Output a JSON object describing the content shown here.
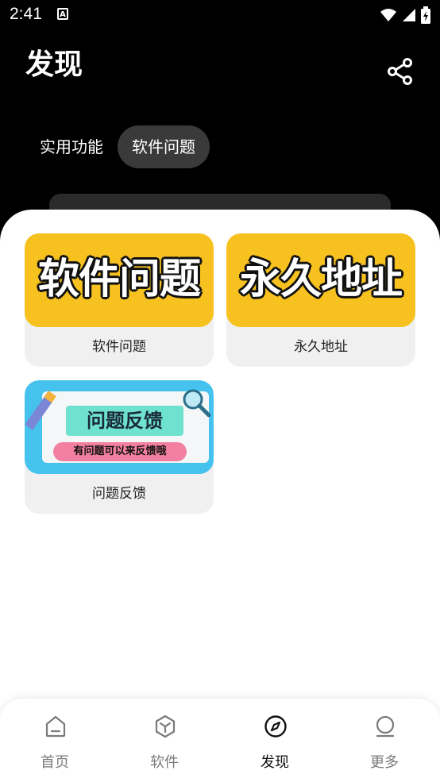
{
  "status_bar": {
    "time": "2:41",
    "notification_letter": "A"
  },
  "header": {
    "title": "发现"
  },
  "tabs": [
    {
      "label": "实用功能",
      "active": false
    },
    {
      "label": "软件问题",
      "active": true
    }
  ],
  "cards": [
    {
      "thumb_text": "软件问题",
      "label": "软件问题",
      "thumb_color": "#f7c21f"
    },
    {
      "thumb_text": "永久地址",
      "label": "永久地址",
      "thumb_color": "#f7c21f"
    },
    {
      "thumb_title": "问题反馈",
      "thumb_sub": "有问题可以来反馈哦",
      "label": "问题反馈",
      "thumb_color": "#45c3ee"
    }
  ],
  "bottom_nav": [
    {
      "label": "首页",
      "icon": "home-icon",
      "active": false
    },
    {
      "label": "软件",
      "icon": "cube-icon",
      "active": false
    },
    {
      "label": "发现",
      "icon": "compass-icon",
      "active": true
    },
    {
      "label": "更多",
      "icon": "profile-icon",
      "active": false
    }
  ]
}
